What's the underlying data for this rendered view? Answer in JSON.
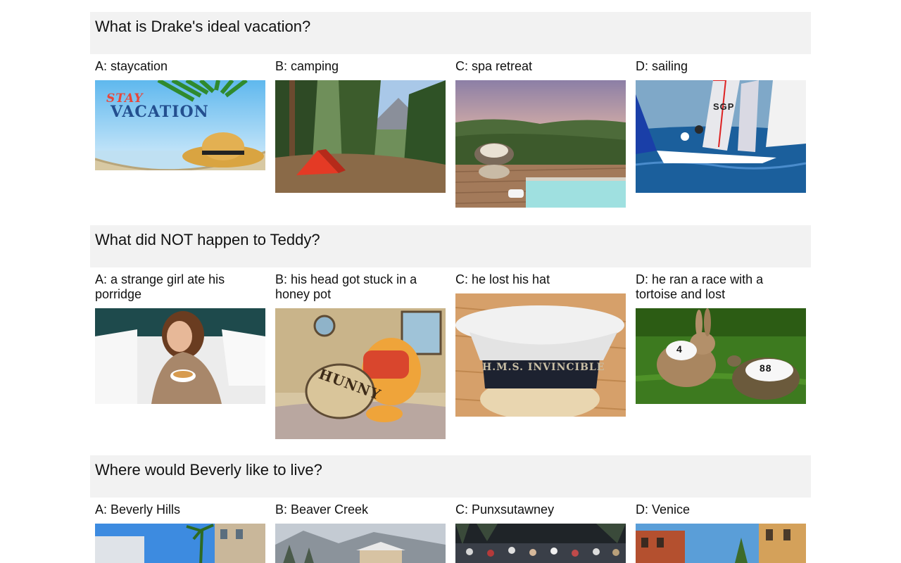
{
  "questions": [
    {
      "text": "What is Drake's ideal vacation?",
      "options": [
        {
          "label": "A: staycation",
          "image": "hammock-straw-hat-photo",
          "image_text_top": "STAY",
          "image_text_main": "VACATION"
        },
        {
          "label": "B: camping",
          "image": "tent-in-forest-photo"
        },
        {
          "label": "C: spa retreat",
          "image": "hot-tub-deck-photo"
        },
        {
          "label": "D: sailing",
          "image": "sailing-dinghy-photo",
          "image_text": "SGP"
        }
      ]
    },
    {
      "text": "What did NOT happen to Teddy?",
      "options": [
        {
          "label": "A: a strange girl ate his porridge",
          "image": "girl-eating-cereal-photo"
        },
        {
          "label": "B: his head got stuck in a honey pot",
          "image": "pooh-honey-pot-image",
          "image_text": "HUNNY"
        },
        {
          "label": "C: he lost his hat",
          "image": "sailor-cap-photo",
          "image_text": "H.M.S. INVINCIBLE"
        },
        {
          "label": "D: he ran a race with a tortoise and lost",
          "image": "hare-and-tortoise-photo",
          "image_text_hare": "4",
          "image_text_tortoise": "88"
        }
      ]
    },
    {
      "text": "Where would Beverly like to live?",
      "options": [
        {
          "label": "A: Beverly Hills",
          "image": "palm-street-photo"
        },
        {
          "label": "B: Beaver Creek",
          "image": "snowy-village-photo"
        },
        {
          "label": "C: Punxsutawney",
          "image": "crowd-photo"
        },
        {
          "label": "D: Venice",
          "image": "venice-buildings-photo"
        }
      ]
    }
  ]
}
